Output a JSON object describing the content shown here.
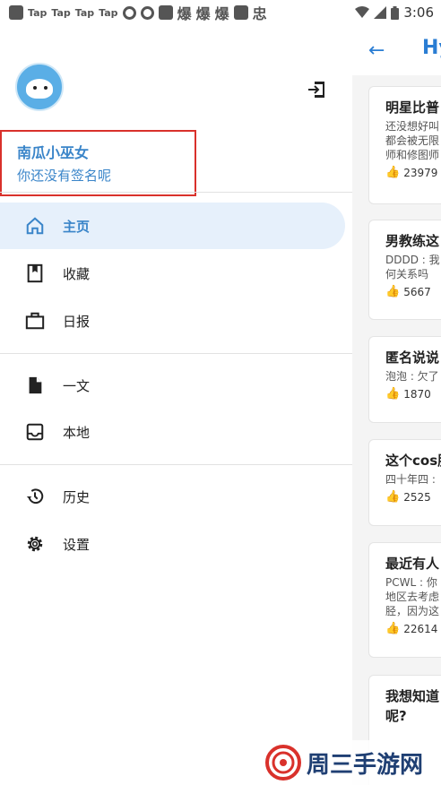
{
  "status_bar": {
    "tap_labels": [
      "Tap",
      "Tap",
      "Tap",
      "Tap"
    ],
    "notif_chars": [
      "爆",
      "爆",
      "爆"
    ],
    "last_char": "忠",
    "time": "3:06"
  },
  "app_bar": {
    "title": "Hy"
  },
  "drawer": {
    "profile": {
      "name": "南瓜小巫女",
      "signature": "你还没有签名呢"
    },
    "nav_groups": [
      [
        {
          "label": "主页",
          "icon": "home-icon",
          "active": true
        },
        {
          "label": "收藏",
          "icon": "bookmark-icon",
          "active": false
        },
        {
          "label": "日报",
          "icon": "briefcase-icon",
          "active": false
        }
      ],
      [
        {
          "label": "一文",
          "icon": "file-icon",
          "active": false
        },
        {
          "label": "本地",
          "icon": "inbox-icon",
          "active": false
        }
      ],
      [
        {
          "label": "历史",
          "icon": "history-icon",
          "active": false
        },
        {
          "label": "设置",
          "icon": "gear-icon",
          "active": false
        }
      ]
    ]
  },
  "feed_cards": [
    {
      "title": "明星比普",
      "excerpt": "还没想好叫\n都会被无限\n师和修图师",
      "likes": "23979"
    },
    {
      "title": "男教练这",
      "excerpt": "DDDD : 我\n何关系吗",
      "likes": "5667"
    },
    {
      "title": "匿名说说",
      "excerpt": "泡泡 : 欠了",
      "likes": "1870"
    },
    {
      "title": "这个cos服",
      "excerpt": "四十年四 :",
      "likes": "2525"
    },
    {
      "title": "最近有人",
      "excerpt": "PCWL : 你\n地区去考虑\n胫，因为这",
      "likes": "22614"
    },
    {
      "title": "我想知道\n呢?",
      "excerpt": "",
      "likes": ""
    }
  ],
  "watermark": {
    "text": "周三手游网"
  },
  "colors": {
    "accent": "#3a85c9",
    "highlight_box": "#d9312b",
    "active_bg": "#e6f0fb"
  }
}
